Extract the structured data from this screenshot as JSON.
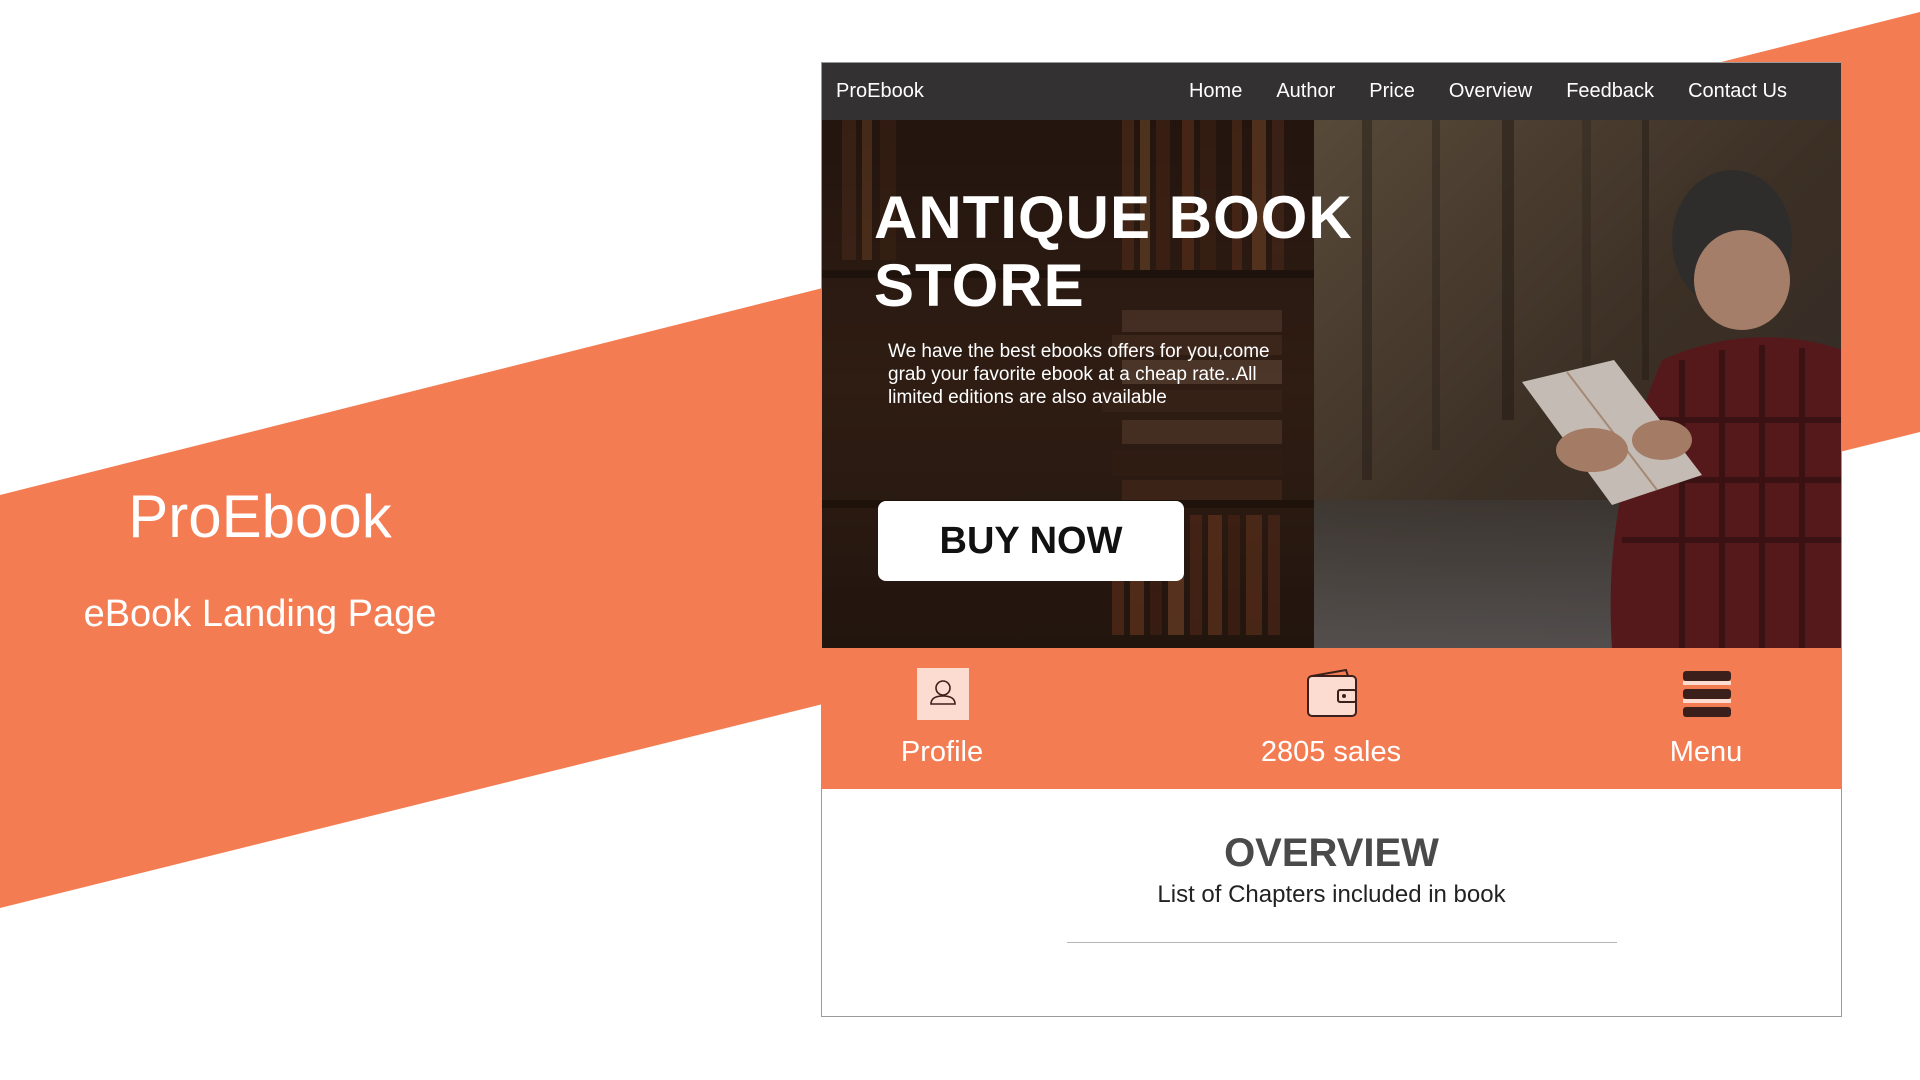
{
  "colors": {
    "accent": "#f47c52",
    "nav_bg": "#333132",
    "text_dark": "#4a4a4a",
    "icon_dark": "#3b1f1a",
    "icon_light": "#fcdcd0"
  },
  "slide": {
    "brand": "ProEbook",
    "subtitle": "eBook Landing Page"
  },
  "nav": {
    "brand": "ProEbook",
    "links": [
      "Home",
      "Author",
      "Price",
      "Overview",
      "Feedback",
      "Contact Us"
    ]
  },
  "hero": {
    "title": "ANTIQUE  BOOK\nSTORE",
    "description": "We have the best ebooks offers for you,come grab your favorite ebook at a cheap rate..All limited editions are also available",
    "cta_label": "BUY NOW"
  },
  "features": [
    {
      "label": "Profile",
      "icon": "profile-icon"
    },
    {
      "label": "2805 sales",
      "icon": "wallet-icon"
    },
    {
      "label": "Menu",
      "icon": "menu-icon"
    }
  ],
  "overview": {
    "title": "OVERVIEW",
    "subtitle": "List of Chapters included in book"
  }
}
